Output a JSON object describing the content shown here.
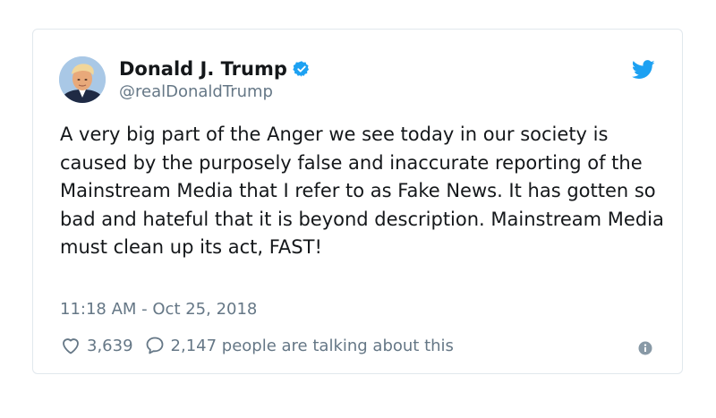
{
  "tweet": {
    "display_name": "Donald J. Trump",
    "handle": "@realDonaldTrump",
    "verified_icon": "verified-badge-icon",
    "brand_icon": "twitter-bird-icon",
    "text": "A very big part of the Anger we see today in our society is caused by the purposely false and inaccurate reporting of the Mainstream Media that I refer to as Fake News. It has gotten so bad and hateful that it is beyond description. Mainstream Media must clean up its act, FAST!",
    "timestamp": "11:18 AM - Oct 25, 2018",
    "likes": "3,639",
    "talking": "2,147 people are talking about this"
  },
  "colors": {
    "brand_blue": "#1da1f2",
    "text_primary": "#14171a",
    "text_secondary": "#657786",
    "border": "#e1e8ed"
  }
}
